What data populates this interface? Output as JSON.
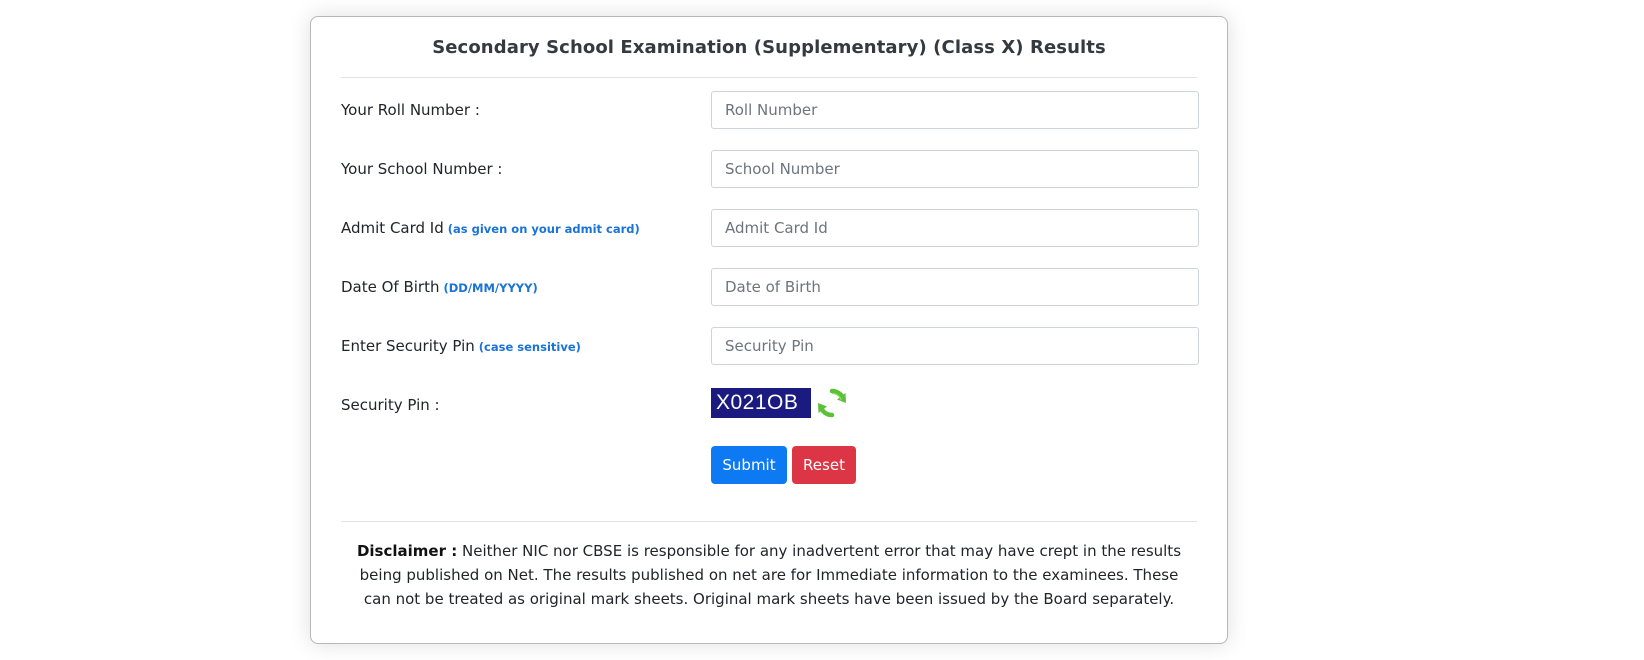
{
  "form": {
    "title": "Secondary School Examination (Supplementary) (Class X) Results",
    "fields": [
      {
        "label": "Your Roll Number :",
        "hint": "",
        "placeholder": "Roll Number"
      },
      {
        "label": "Your School Number :",
        "hint": "",
        "placeholder": "School Number"
      },
      {
        "label": "Admit Card Id",
        "hint": "(as given on your admit card)",
        "placeholder": "Admit Card Id"
      },
      {
        "label": "Date Of Birth",
        "hint": "(DD/MM/YYYY)",
        "placeholder": "Date of Birth"
      },
      {
        "label": "Enter Security Pin",
        "hint": "(case sensitive)",
        "placeholder": "Security Pin"
      }
    ],
    "security_pin": {
      "label": "Security Pin :",
      "captcha_text": "X021OB",
      "refresh_icon": "refresh-icon"
    },
    "buttons": {
      "submit_label": "Submit",
      "reset_label": "Reset"
    },
    "disclaimer": {
      "heading": "Disclaimer :",
      "text": "Neither NIC nor CBSE is responsible for any inadvertent error that may have crept in the results being published on Net. The results published on net are for Immediate information to the examinees. These can not be treated as original mark sheets. Original mark sheets have been issued by the Board separately."
    }
  },
  "colors": {
    "hint": "#1a73d6",
    "submit": "#0d79f2",
    "reset": "#dc3545",
    "captcha_bg": "#1a1a80",
    "refresh": "#5cc13a"
  }
}
